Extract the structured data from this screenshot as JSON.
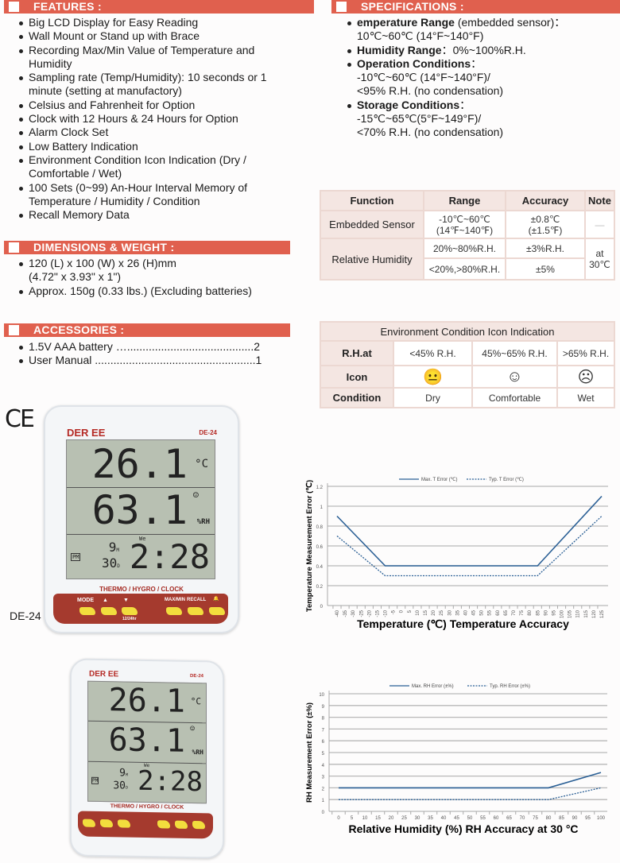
{
  "features": {
    "title": "FEATURES",
    "items": [
      "Big LCD Display for Easy Reading",
      "Wall Mount or Stand up with Brace",
      "Recording Max/Min Value of Temperature and Humidity",
      "Sampling rate (Temp/Humidity): 10 seconds or  1 minute (setting at manufactory)",
      "Celsius and Fahrenheit for Option",
      "Clock with 12 Hours & 24 Hours for Option",
      "Alarm Clock Set",
      "Low Battery Indication",
      "Environment Condition Icon Indication (Dry / Comfortable / Wet)",
      "100 Sets (0~99) An-Hour Interval Memory of Temperature / Humidity / Condition",
      "Recall Memory Data"
    ]
  },
  "specifications": {
    "title": "SPECIFICATIONS",
    "items": [
      {
        "label": "emperature Range",
        "suffix": " (embedded sensor)：",
        "value": "10℃~60℃ (14°F~140°F)"
      },
      {
        "label": "Humidity Range",
        "suffix": "：0%~100%R.H.",
        "value": ""
      },
      {
        "label": "Operation Conditions",
        "suffix": "：",
        "value": "-10℃~60℃ (14°F~140°F)/",
        "value2": "<95% R.H. (no condensation)"
      },
      {
        "label": "Storage Conditions",
        "suffix": "：",
        "value": "-15℃~65℃(5°F~149°F)/",
        "value2": "<70% R.H. (no condensation)"
      }
    ]
  },
  "dimensions": {
    "title": "DIMENSIONS & WEIGHT",
    "items": [
      "120 (L) x 100 (W) x 26 (H)mm (4.72\" x 3.93\" x 1\")",
      "Approx. 150g  (0.33 lbs.) (Excluding batteries)"
    ]
  },
  "accessories": {
    "title": "ACCESSORIES",
    "items": [
      "1.5V AAA battery ….........................................2",
      "User Manual ....................................................1"
    ]
  },
  "accuracy_table": {
    "headers": [
      "Function",
      "Range",
      "Accuracy",
      "Note"
    ],
    "rows": [
      {
        "function": "Embedded Sensor",
        "range": "-10℃~60℃",
        "range2": "(14℉~140℉)",
        "accuracy": "±0.8℃",
        "accuracy2": "(±1.5℉)",
        "note": "—"
      },
      {
        "function": "Relative Humidity",
        "range": "20%~80%R.H.",
        "accuracy": "±3%R.H.",
        "note": "at 30℃",
        "range_b": "<20%,>80%R.H.",
        "accuracy_b": "±5%"
      }
    ]
  },
  "condition_table": {
    "title": "Environment Condition Icon Indication",
    "row_labels": [
      "R.H.at",
      "Icon",
      "Condition"
    ],
    "ranges": [
      "<45% R.H.",
      "45%~65% R.H.",
      ">65% R.H."
    ],
    "icons": [
      "neutral-face-icon",
      "smiling-face-icon",
      "frowning-face-icon"
    ],
    "icon_glyphs": [
      "😐",
      "☺",
      "☹"
    ],
    "conditions": [
      "Dry",
      "Comfortable",
      "Wet"
    ]
  },
  "ce_mark": "CE",
  "device": {
    "brand": "DER EE",
    "model": "DE-24",
    "caption": "DE-24",
    "temp": "26.1",
    "temp_unit": "°C",
    "humidity": "63.1",
    "humidity_unit": "%RH",
    "weekday": "We",
    "pm": "PM",
    "month": "9",
    "month_unit": "M",
    "day": "30",
    "day_unit": "D",
    "time": "2:28",
    "face": "☺",
    "panel_title": "THERMO / HYGRO / CLOCK",
    "buttons": [
      "MODE",
      "▲",
      "▼",
      "MAX/MIN",
      "RECALL",
      "🔔"
    ],
    "sub_label": "12/24hr"
  },
  "chart_data": [
    {
      "type": "line",
      "title": "",
      "xlabel": "Temperature  (℃)  Temperature Accuracy",
      "ylabel": "Temperature Measurement Error (℃)",
      "x_ticks": [
        -40,
        -35,
        -30,
        -25,
        -20,
        -15,
        -10,
        -5,
        0,
        5,
        10,
        15,
        20,
        25,
        30,
        35,
        40,
        45,
        50,
        55,
        60,
        65,
        70,
        75,
        80,
        85,
        90,
        95,
        100,
        105,
        110,
        115,
        120,
        125
      ],
      "y_ticks": [
        0,
        0.2,
        0.4,
        0.6,
        0.8,
        1,
        1.2
      ],
      "xlim": [
        -40,
        125
      ],
      "ylim": [
        0,
        1.2
      ],
      "grid": true,
      "legend": "top",
      "series": [
        {
          "name": "Max. T Error (℃)",
          "style": "solid",
          "points": [
            [
              -40,
              0.9
            ],
            [
              -10,
              0.4
            ],
            [
              85,
              0.4
            ],
            [
              125,
              1.1
            ]
          ]
        },
        {
          "name": "Typ. T Error (℃)",
          "style": "dotted",
          "points": [
            [
              -40,
              0.7
            ],
            [
              -10,
              0.3
            ],
            [
              85,
              0.3
            ],
            [
              125,
              0.9
            ]
          ]
        }
      ],
      "color": "#2a5f95"
    },
    {
      "type": "line",
      "title": "",
      "xlabel": "Relative Humidity  (%)  RH Accuracy at 30 °C",
      "ylabel": "RH Measurement Error (±%)",
      "x_ticks": [
        0,
        5,
        10,
        15,
        20,
        25,
        30,
        35,
        40,
        45,
        50,
        55,
        60,
        65,
        70,
        75,
        80,
        85,
        90,
        95,
        100
      ],
      "y_ticks": [
        0,
        1,
        2,
        3,
        4,
        5,
        6,
        7,
        8,
        9,
        10
      ],
      "xlim": [
        0,
        100
      ],
      "ylim": [
        0,
        10
      ],
      "grid": true,
      "legend": "top",
      "series": [
        {
          "name": "Max. RH Error (±%)",
          "style": "solid",
          "points": [
            [
              0,
              2
            ],
            [
              80,
              2
            ],
            [
              100,
              3.3
            ]
          ]
        },
        {
          "name": "Typ. RH Error (±%)",
          "style": "dotted",
          "points": [
            [
              0,
              1
            ],
            [
              80,
              1
            ],
            [
              100,
              2
            ]
          ]
        }
      ],
      "color": "#2a5f95"
    }
  ]
}
